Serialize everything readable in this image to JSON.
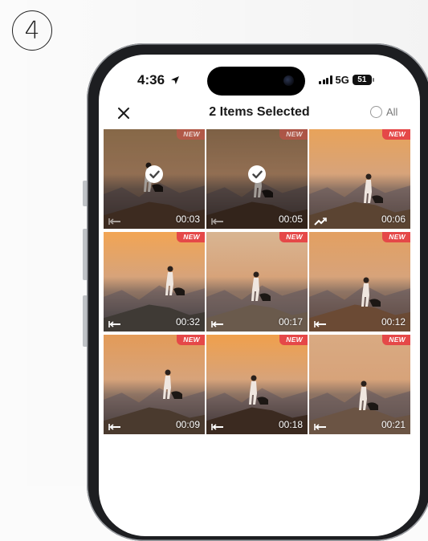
{
  "step_number": "4",
  "status_bar": {
    "time": "4:36",
    "network": "5G",
    "battery": "51"
  },
  "nav": {
    "title": "2 Items Selected",
    "select_all_label": "All"
  },
  "tiles": [
    {
      "duration": "00:03",
      "selected": true,
      "type": "forward",
      "sky": "#c79a6a",
      "land": "#5a4030"
    },
    {
      "duration": "00:05",
      "selected": true,
      "type": "forward",
      "sky": "#b98f66",
      "land": "#4c3628"
    },
    {
      "duration": "00:06",
      "selected": false,
      "type": "speed",
      "sky": "#e8a35a",
      "land": "#5b4432"
    },
    {
      "duration": "00:32",
      "selected": false,
      "type": "forward",
      "sky": "#f2a554",
      "land": "#3f3a35"
    },
    {
      "duration": "00:17",
      "selected": false,
      "type": "forward",
      "sky": "#d8b592",
      "land": "#6a5a4c"
    },
    {
      "duration": "00:12",
      "selected": false,
      "type": "forward",
      "sky": "#e3a061",
      "land": "#6b4a34"
    },
    {
      "duration": "00:09",
      "selected": false,
      "type": "forward",
      "sky": "#e39b58",
      "land": "#4a3a2e"
    },
    {
      "duration": "00:18",
      "selected": false,
      "type": "forward",
      "sky": "#f0a04c",
      "land": "#3b2a20"
    },
    {
      "duration": "00:21",
      "selected": false,
      "type": "forward",
      "sky": "#d9aa82",
      "land": "#6b5444"
    }
  ],
  "badge_label": "NEW",
  "icons": {
    "close": "close-icon",
    "location": "location-arrow-icon",
    "check": "check-icon"
  }
}
